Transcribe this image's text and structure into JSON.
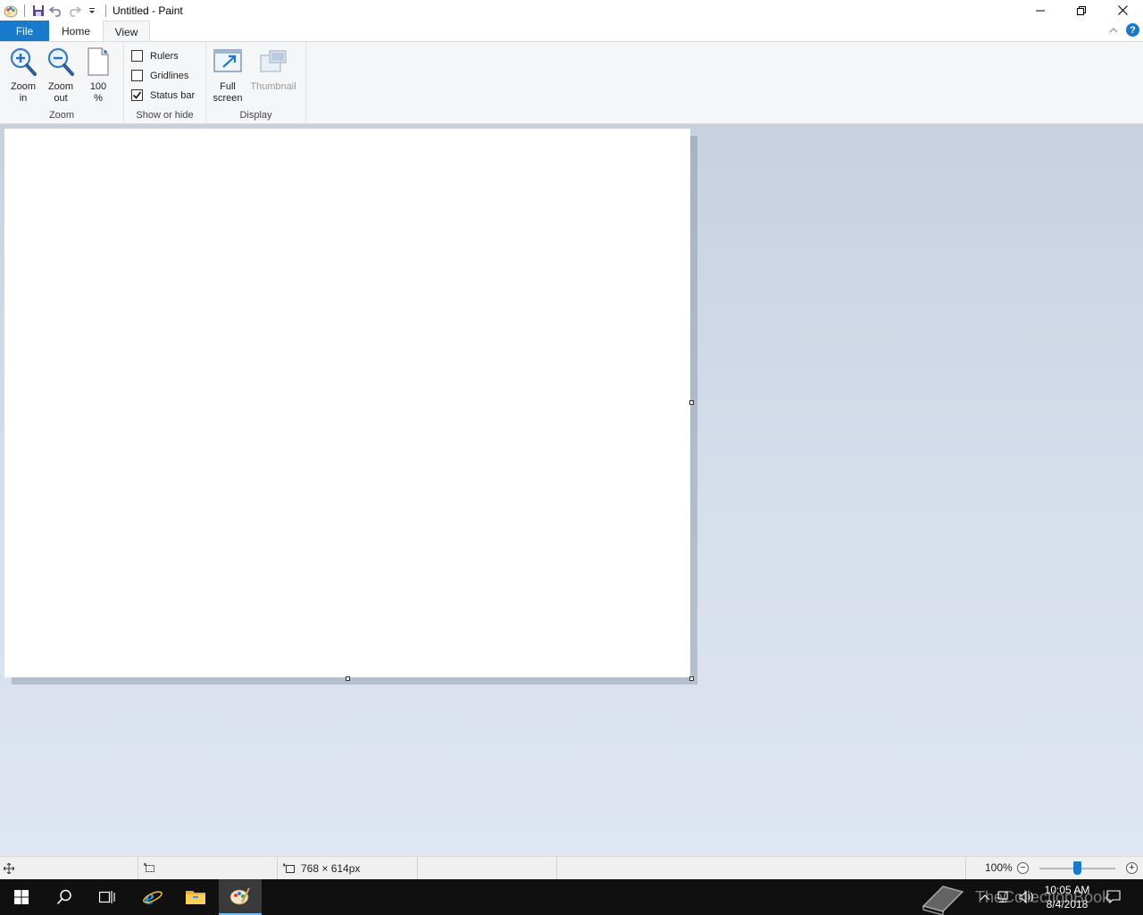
{
  "window": {
    "title": "Untitled - Paint"
  },
  "tabs": [
    {
      "label": "File"
    },
    {
      "label": "Home"
    },
    {
      "label": "View"
    }
  ],
  "ribbon": {
    "zoom_group": {
      "label": "Zoom",
      "zoom_in": {
        "line1": "Zoom",
        "line2": "in"
      },
      "zoom_out": {
        "line1": "Zoom",
        "line2": "out"
      },
      "actual": {
        "line1": "100",
        "line2": "%"
      }
    },
    "show_hide_group": {
      "label": "Show or hide",
      "rulers": {
        "label": "Rulers",
        "checked": false
      },
      "gridlines": {
        "label": "Gridlines",
        "checked": false
      },
      "status_bar": {
        "label": "Status bar",
        "checked": true
      }
    },
    "display_group": {
      "label": "Display",
      "full_screen": {
        "line1": "Full",
        "line2": "screen"
      },
      "thumbnail": {
        "label": "Thumbnail",
        "enabled": false
      }
    }
  },
  "statusbar": {
    "image_size": "768 × 614px",
    "zoom_level": "100%",
    "zoom_fraction": 0.5
  },
  "taskbar": {
    "watermark": "TheCollectionBook",
    "time": "10:05 AM",
    "date": "8/4/2018"
  },
  "colors": {
    "accent": "#1979ca",
    "ribbon_bg": "#f5f6f7",
    "workspace_top": "#c8d1e0",
    "workspace_bottom": "#dde6f1",
    "taskbar_bg": "#101010"
  }
}
